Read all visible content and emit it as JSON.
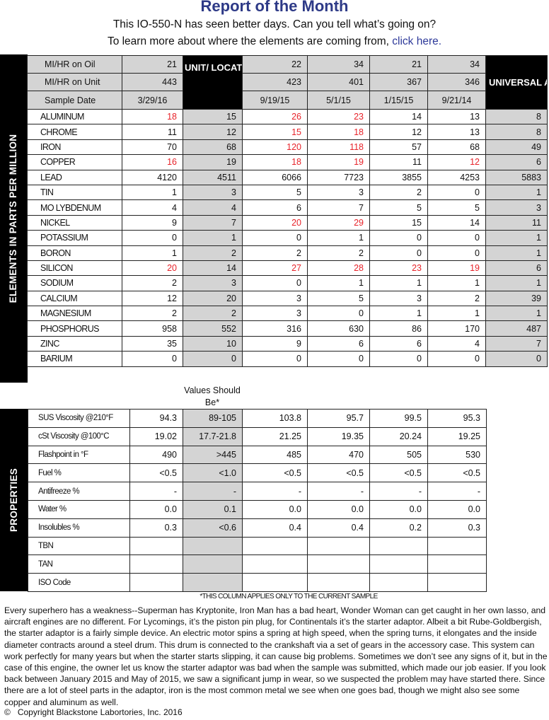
{
  "header": {
    "title": "Report of the Month",
    "subtitle": "This IO-550-N has seen better days. Can you tell what’s going on?",
    "learn_more_prefix": "To learn more about where the elements are coming from, ",
    "learn_more_link": "click here."
  },
  "elements_section": {
    "side_label": "ELEMENTS IN PARTS PER MILLION",
    "unit_location_header": "UNIT/ LOCATION AVERAGES",
    "universal_header": "UNIVERSAL AVERAGES",
    "mi_hr_on_oil_label": "MI/HR on Oil",
    "mi_hr_on_unit_label": "MI/HR on Unit",
    "sample_date_label": "Sample Date",
    "samples": [
      {
        "mi_hr_on_oil": "21",
        "mi_hr_on_unit": "443",
        "sample_date": "3/29/16"
      },
      {
        "mi_hr_on_oil": "22",
        "mi_hr_on_unit": "423",
        "sample_date": "9/19/15"
      },
      {
        "mi_hr_on_oil": "34",
        "mi_hr_on_unit": "401",
        "sample_date": "5/1/15"
      },
      {
        "mi_hr_on_oil": "21",
        "mi_hr_on_unit": "367",
        "sample_date": "1/15/15"
      },
      {
        "mi_hr_on_oil": "34",
        "mi_hr_on_unit": "346",
        "sample_date": "9/21/14"
      }
    ],
    "highlight_color": "#e8232a",
    "rows": [
      {
        "name": "ALUMINUM",
        "s1": "18",
        "unit_avg": "15",
        "s2": "26",
        "s3": "23",
        "s4": "14",
        "s5": "13",
        "universal": "8",
        "flags": [
          1,
          0,
          1,
          1,
          0,
          0
        ]
      },
      {
        "name": "CHROME",
        "s1": "11",
        "unit_avg": "12",
        "s2": "15",
        "s3": "18",
        "s4": "12",
        "s5": "13",
        "universal": "8",
        "flags": [
          0,
          0,
          1,
          1,
          0,
          0
        ]
      },
      {
        "name": "IRON",
        "s1": "70",
        "unit_avg": "68",
        "s2": "120",
        "s3": "118",
        "s4": "57",
        "s5": "68",
        "universal": "49",
        "flags": [
          0,
          0,
          1,
          1,
          0,
          0
        ]
      },
      {
        "name": "COPPER",
        "s1": "16",
        "unit_avg": "19",
        "s2": "18",
        "s3": "19",
        "s4": "11",
        "s5": "12",
        "universal": "6",
        "flags": [
          1,
          0,
          1,
          1,
          0,
          1
        ]
      },
      {
        "name": "LEAD",
        "s1": "4120",
        "unit_avg": "4511",
        "s2": "6066",
        "s3": "7723",
        "s4": "3855",
        "s5": "4253",
        "universal": "5883",
        "flags": [
          0,
          0,
          0,
          0,
          0,
          0
        ]
      },
      {
        "name": "TIN",
        "s1": "1",
        "unit_avg": "3",
        "s2": "5",
        "s3": "3",
        "s4": "2",
        "s5": "0",
        "universal": "1",
        "flags": [
          0,
          0,
          0,
          0,
          0,
          0
        ]
      },
      {
        "name": "MO LYBDENUM",
        "s1": "4",
        "unit_avg": "4",
        "s2": "6",
        "s3": "7",
        "s4": "5",
        "s5": "5",
        "universal": "3",
        "flags": [
          0,
          0,
          0,
          0,
          0,
          0
        ]
      },
      {
        "name": "NICKEL",
        "s1": "9",
        "unit_avg": "7",
        "s2": "20",
        "s3": "29",
        "s4": "15",
        "s5": "14",
        "universal": "11",
        "flags": [
          0,
          0,
          1,
          1,
          0,
          0
        ]
      },
      {
        "name": "POTASSIUM",
        "s1": "0",
        "unit_avg": "1",
        "s2": "0",
        "s3": "1",
        "s4": "0",
        "s5": "0",
        "universal": "1",
        "flags": [
          0,
          0,
          0,
          0,
          0,
          0
        ]
      },
      {
        "name": "BORON",
        "s1": "1",
        "unit_avg": "2",
        "s2": "2",
        "s3": "2",
        "s4": "0",
        "s5": "0",
        "universal": "1",
        "flags": [
          0,
          0,
          0,
          0,
          0,
          0
        ]
      },
      {
        "name": "SILICON",
        "s1": "20",
        "unit_avg": "14",
        "s2": "27",
        "s3": "28",
        "s4": "23",
        "s5": "19",
        "universal": "6",
        "flags": [
          1,
          0,
          1,
          1,
          1,
          1
        ]
      },
      {
        "name": "SODIUM",
        "s1": "2",
        "unit_avg": "3",
        "s2": "0",
        "s3": "1",
        "s4": "1",
        "s5": "1",
        "universal": "1",
        "flags": [
          0,
          0,
          0,
          0,
          0,
          0
        ]
      },
      {
        "name": "CALCIUM",
        "s1": "12",
        "unit_avg": "20",
        "s2": "3",
        "s3": "5",
        "s4": "3",
        "s5": "2",
        "universal": "39",
        "flags": [
          0,
          0,
          0,
          0,
          0,
          0
        ]
      },
      {
        "name": "MAGNESIUM",
        "s1": "2",
        "unit_avg": "2",
        "s2": "3",
        "s3": "0",
        "s4": "1",
        "s5": "1",
        "universal": "1",
        "flags": [
          0,
          0,
          0,
          0,
          0,
          0
        ]
      },
      {
        "name": "PHOSPHORUS",
        "s1": "958",
        "unit_avg": "552",
        "s2": "316",
        "s3": "630",
        "s4": "86",
        "s5": "170",
        "universal": "487",
        "flags": [
          0,
          0,
          0,
          0,
          0,
          0
        ]
      },
      {
        "name": "ZINC",
        "s1": "35",
        "unit_avg": "10",
        "s2": "9",
        "s3": "6",
        "s4": "6",
        "s5": "4",
        "universal": "7",
        "flags": [
          0,
          0,
          0,
          0,
          0,
          0
        ]
      },
      {
        "name": "BARIUM",
        "s1": "0",
        "unit_avg": "0",
        "s2": "0",
        "s3": "0",
        "s4": "0",
        "s5": "0",
        "universal": "0",
        "flags": [
          0,
          0,
          0,
          0,
          0,
          0
        ]
      }
    ]
  },
  "properties_section": {
    "side_label": "PROPERTIES",
    "values_should_be_label": "Values Should Be*",
    "rows": [
      {
        "name": "SUS Viscosity @210°F",
        "s1": "94.3",
        "should_be": "89-105",
        "s2": "103.8",
        "s3": "95.7",
        "s4": "99.5",
        "s5": "95.3"
      },
      {
        "name": "cSt Viscosity @100°C",
        "s1": "19.02",
        "should_be": "17.7-21.8",
        "s2": "21.25",
        "s3": "19.35",
        "s4": "20.24",
        "s5": "19.25"
      },
      {
        "name": "Flashpoint in °F",
        "s1": "490",
        "should_be": ">445",
        "s2": "485",
        "s3": "470",
        "s4": "505",
        "s5": "530"
      },
      {
        "name": "Fuel %",
        "s1": "<0.5",
        "should_be": "<1.0",
        "s2": "<0.5",
        "s3": "<0.5",
        "s4": "<0.5",
        "s5": "<0.5"
      },
      {
        "name": "Antifreeze %",
        "s1": "-",
        "should_be": "-",
        "s2": "-",
        "s3": "-",
        "s4": "-",
        "s5": "-"
      },
      {
        "name": "Water %",
        "s1": "0.0",
        "should_be": "0.1",
        "s2": "0.0",
        "s3": "0.0",
        "s4": "0.0",
        "s5": "0.0"
      },
      {
        "name": "Insolubles %",
        "s1": "0.3",
        "should_be": "<0.6",
        "s2": "0.4",
        "s3": "0.4",
        "s4": "0.2",
        "s5": "0.3"
      },
      {
        "name": "TBN",
        "s1": "",
        "should_be": "",
        "s2": "",
        "s3": "",
        "s4": "",
        "s5": ""
      },
      {
        "name": "TAN",
        "s1": "",
        "should_be": "",
        "s2": "",
        "s3": "",
        "s4": "",
        "s5": ""
      },
      {
        "name": "ISO Code",
        "s1": "",
        "should_be": "",
        "s2": "",
        "s3": "",
        "s4": "",
        "s5": ""
      }
    ],
    "footnote": "*THIS COLUMN APPLIES ONLY TO THE CURRENT SAMPLE"
  },
  "commentary": "Every superhero has a weakness--Superman has Kryptonite, Iron Man has a bad heart, Wonder Woman can get caught in her own lasso, and aircraft engines are no different. For Lycomings, it’s the piston pin plug, for Continentals it’s the starter adaptor. Albeit a bit Rube-Goldbergish, the starter adaptor is a fairly simple device. An electric motor spins a spring at high speed, when the spring turns, it elongates and the inside diameter contracts around a steel drum. This drum is connected to the crankshaft via a set of gears in the accessory case. This system can work perfectly for many years but when the starter starts slipping, it can cause big problems. Sometimes we don’t see any signs of it, but in the case of this engine, the owner let us know the starter adaptor was bad when the sample was submitted, which made our job easier. If you look back between January 2015 and May of 2015, we saw a significant jump in wear, so we suspected the problem may have started there. Since there are a lot of steel parts in the adaptor, iron is the most common metal we see when one goes bad, though we might also see some copper and aluminum as well.",
  "footer": {
    "copyright_symbol": "©",
    "copyright_text": "Copyright Blackstone Labortories, Inc.  2016"
  }
}
